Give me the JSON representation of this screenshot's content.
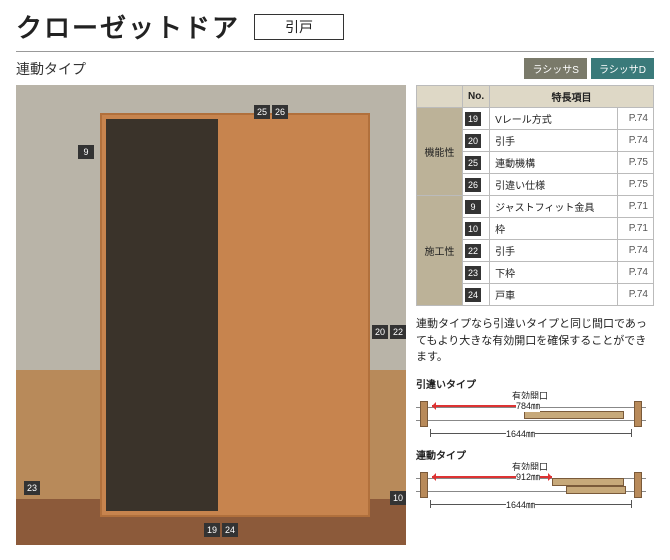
{
  "header": {
    "title": "クローゼットドア",
    "subtitle": "引戸"
  },
  "subtype": "連動タイプ",
  "tags": [
    "ラシッサS",
    "ラシッサD"
  ],
  "callouts_top": [
    "25",
    "26"
  ],
  "callout_left": "9",
  "callouts_right_mid": [
    "20",
    "22"
  ],
  "callouts_bot_left": "23",
  "callouts_bot_center": [
    "19",
    "24"
  ],
  "callout_bot_right": "10",
  "spec": {
    "head": {
      "no": "No.",
      "item": "特長項目",
      "page": ""
    },
    "groups": [
      {
        "name": "機能性",
        "rows": [
          {
            "no": "19",
            "item": "Vレール方式",
            "page": "P.74"
          },
          {
            "no": "20",
            "item": "引手",
            "page": "P.74"
          },
          {
            "no": "25",
            "item": "連動機構",
            "page": "P.75"
          },
          {
            "no": "26",
            "item": "引違い仕様",
            "page": "P.75"
          }
        ]
      },
      {
        "name": "施工性",
        "rows": [
          {
            "no": "9",
            "item": "ジャストフィット金具",
            "page": "P.71"
          },
          {
            "no": "10",
            "item": "枠",
            "page": "P.71"
          },
          {
            "no": "22",
            "item": "引手",
            "page": "P.74"
          },
          {
            "no": "23",
            "item": "下枠",
            "page": "P.74"
          },
          {
            "no": "24",
            "item": "戸車",
            "page": "P.74"
          }
        ]
      }
    ]
  },
  "desc": "連動タイプなら引違いタイプと同じ間口であってもより大きな有効開口を確保することができます。",
  "diagrams": {
    "d1": {
      "label": "引違いタイプ",
      "opening_label": "有効開口",
      "opening": "784㎜",
      "total": "1644㎜"
    },
    "d2": {
      "label": "連動タイプ",
      "opening_label": "有効開口",
      "opening": "912㎜",
      "total": "1644㎜"
    }
  },
  "chart_data": [
    {
      "type": "diagram",
      "name": "引違いタイプ",
      "total_width_mm": 1644,
      "effective_opening_mm": 784
    },
    {
      "type": "diagram",
      "name": "連動タイプ",
      "total_width_mm": 1644,
      "effective_opening_mm": 912
    }
  ]
}
